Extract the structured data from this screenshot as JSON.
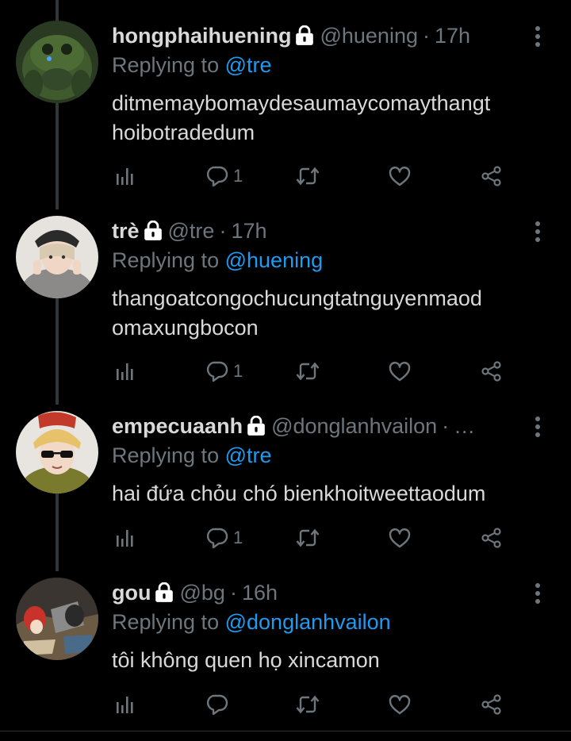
{
  "colors": {
    "background": "#000000",
    "text": "#d9d9d9",
    "muted": "#6e767d",
    "accent": "#1d9bf0"
  },
  "tweets": [
    {
      "name": "hongphaihuening",
      "handle": "@huening",
      "time": "17h",
      "reply_prefix": "Replying to",
      "reply_to": "@tre",
      "text": "ditmemaybomaydesaumaycomaythangt\nhoibotradedum",
      "reply_count": "1",
      "icons": [
        "analytics-icon",
        "reply-icon",
        "retweet-icon",
        "like-icon",
        "share-icon"
      ]
    },
    {
      "name": "trè",
      "handle": "@tre",
      "time": "17h",
      "reply_prefix": "Replying to",
      "reply_to": "@huening",
      "text": "thangoatcongochucungtatnguyenmaod\nomaxungbocon",
      "reply_count": "1",
      "icons": [
        "analytics-icon",
        "reply-icon",
        "retweet-icon",
        "like-icon",
        "share-icon"
      ]
    },
    {
      "name": "empecuaanh",
      "handle": "@donglanhvailon",
      "time": "…",
      "reply_prefix": "Replying to",
      "reply_to": "@tre",
      "text": "hai đứa chỏu chó bienkhoitweettaodum",
      "reply_count": "1",
      "icons": [
        "analytics-icon",
        "reply-icon",
        "retweet-icon",
        "like-icon",
        "share-icon"
      ]
    },
    {
      "name": "gou",
      "handle": "@bg",
      "time": "16h",
      "reply_prefix": "Replying to",
      "reply_to": "@donglanhvailon",
      "text": "tôi không quen họ xincamon",
      "reply_count": "",
      "icons": [
        "analytics-icon",
        "reply-icon",
        "retweet-icon",
        "like-icon",
        "share-icon"
      ]
    }
  ]
}
